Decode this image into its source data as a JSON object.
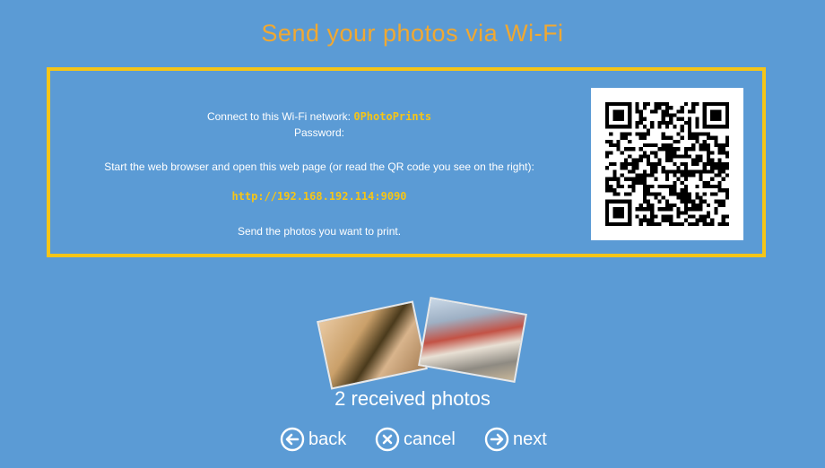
{
  "title": "Send your photos via Wi-Fi",
  "instructions": {
    "network_prefix": "Connect to this Wi-Fi network: ",
    "network_name": "0PhotoPrints",
    "password_label": "Password:",
    "browser_text": "Start the web browser and open this web page (or read the QR code you see on the right):",
    "url": "http://192.168.192.114:9090",
    "send_text": "Send the photos you want to print."
  },
  "received": {
    "text": "2 received photos",
    "count": 2
  },
  "nav": {
    "back_label": "back",
    "back_icon": "arrow-left-circle-icon",
    "cancel_label": "cancel",
    "cancel_icon": "x-circle-icon",
    "next_label": "next",
    "next_icon": "arrow-right-circle-icon"
  },
  "colors": {
    "background": "#5b9bd5",
    "accent_yellow": "#f5c518",
    "title_orange": "#f0a832",
    "text": "#ffffff"
  }
}
